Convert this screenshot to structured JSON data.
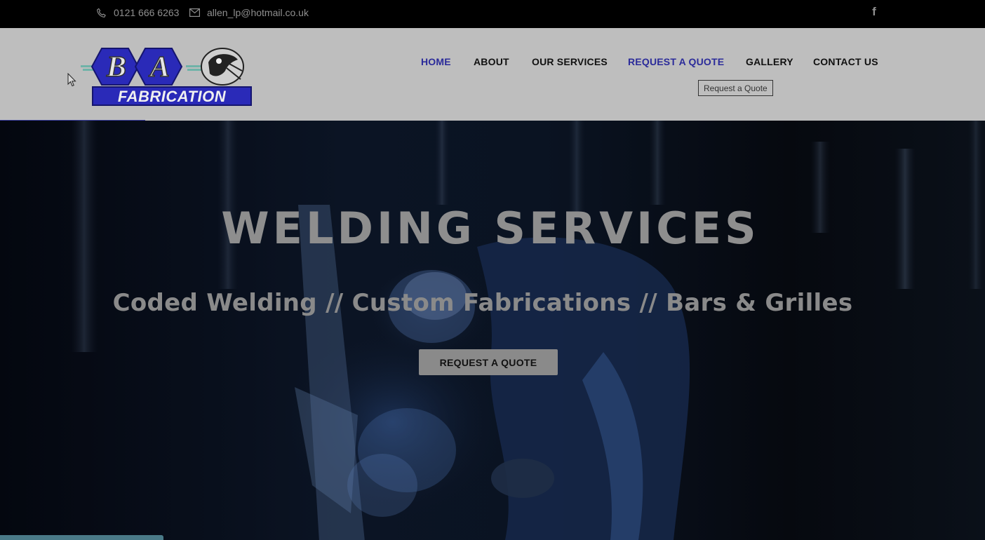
{
  "topbar": {
    "phone": "0121 666 6263",
    "email": "allen_lp@hotmail.co.uk",
    "social_icon": "facebook-icon",
    "social_glyph": "f"
  },
  "header": {
    "logo": {
      "letters": [
        "B",
        "A"
      ],
      "word": "FABRICATION"
    },
    "nav": [
      {
        "label": "HOME",
        "active": true
      },
      {
        "label": "ABOUT",
        "active": false
      },
      {
        "label": "OUR SERVICES",
        "active": false
      },
      {
        "label": "REQUEST A QUOTE",
        "active": true
      },
      {
        "label": "GALLERY",
        "active": false
      },
      {
        "label": "CONTACT US",
        "active": false
      }
    ],
    "tooltip": "Request a Quote"
  },
  "hero": {
    "title": "WELDING SERVICES",
    "subtitle": "Coded Welding // Custom Fabrications // Bars & Grilles",
    "cta": "REQUEST A QUOTE"
  },
  "colors": {
    "topbar_bg": "#000000",
    "header_bg": "#bebebe",
    "nav_active": "#2b2b9a",
    "logo_blue": "#2a2ab8",
    "hero_text": "#8e8e8e"
  }
}
